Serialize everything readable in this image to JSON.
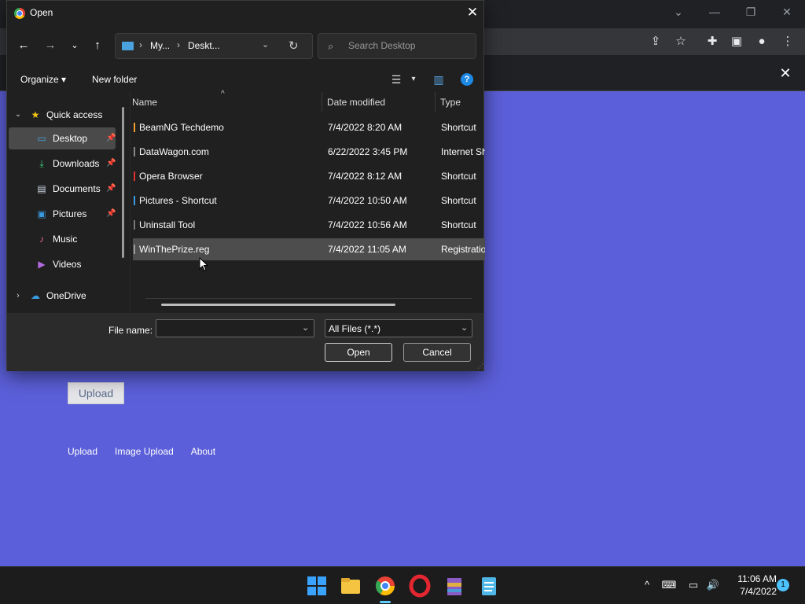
{
  "browser": {
    "window_controls": [
      "⌄",
      "—",
      "❐",
      "✕"
    ],
    "toolbar_icons": [
      "share-icon",
      "star-icon",
      "extensions-icon",
      "sidepanel-icon",
      "profile-icon",
      "menu-icon"
    ],
    "bar_close": "✕"
  },
  "page": {
    "upload_button": "Upload",
    "links": [
      "Upload",
      "Image Upload",
      "About"
    ]
  },
  "dialog": {
    "title": "Open",
    "address": {
      "crumbs": [
        "My...",
        "Deskt..."
      ]
    },
    "search_placeholder": "Search Desktop",
    "commands": {
      "organize": "Organize ▾",
      "new_folder": "New folder"
    },
    "nav": [
      {
        "label": "Quick access",
        "icon": "★",
        "pinned": false
      },
      {
        "label": "Desktop",
        "icon": "▭",
        "pinned": true
      },
      {
        "label": "Downloads",
        "icon": "⤓",
        "pinned": true
      },
      {
        "label": "Documents",
        "icon": "▤",
        "pinned": true
      },
      {
        "label": "Pictures",
        "icon": "▣",
        "pinned": true
      },
      {
        "label": "Music",
        "icon": "♪",
        "pinned": false
      },
      {
        "label": "Videos",
        "icon": "▶",
        "pinned": false
      },
      {
        "label": "OneDrive",
        "icon": "☁",
        "pinned": false
      }
    ],
    "columns": [
      "Name",
      "Date modified",
      "Type"
    ],
    "files": [
      {
        "name": "BeamNG Techdemo",
        "date": "7/4/2022 8:20 AM",
        "type": "Shortcut",
        "mark": "#f0a030"
      },
      {
        "name": "DataWagon.com",
        "date": "6/22/2022 3:45 PM",
        "type": "Internet Sh",
        "mark": "#888888"
      },
      {
        "name": "Opera Browser",
        "date": "7/4/2022 8:12 AM",
        "type": "Shortcut",
        "mark": "#e03030"
      },
      {
        "name": "Pictures - Shortcut",
        "date": "7/4/2022 10:50 AM",
        "type": "Shortcut",
        "mark": "#3a9ae0"
      },
      {
        "name": "Uninstall Tool",
        "date": "7/4/2022 10:56 AM",
        "type": "Shortcut",
        "mark": "#777777"
      },
      {
        "name": "WinThePrize.reg",
        "date": "7/4/2022 11:05 AM",
        "type": "Registratio",
        "mark": "#999999",
        "selected": true
      }
    ],
    "file_name_label": "File name:",
    "file_name_value": "",
    "filter": "All Files (*.*)",
    "open_button": "Open",
    "cancel_button": "Cancel"
  },
  "taskbar": {
    "apps": [
      "start",
      "file-explorer",
      "chrome",
      "opera",
      "winrar",
      "notepad"
    ],
    "tray": [
      "^",
      "⌨",
      "▭",
      "🔊"
    ],
    "time": "11:06 AM",
    "date": "7/4/2022",
    "notifications": "1"
  }
}
